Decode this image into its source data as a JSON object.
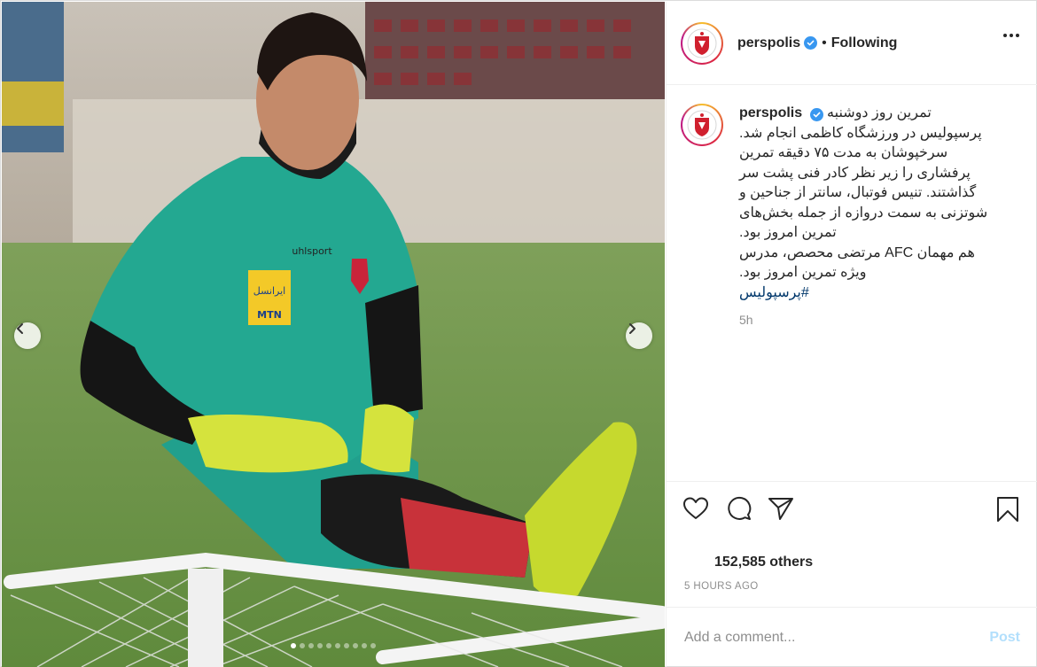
{
  "post": {
    "username": "perspolis",
    "separator": "•",
    "follow_status": "Following",
    "more_icon": "more-horizontal-icon",
    "verified_icon": "verified-badge-icon",
    "brand_color": "#3897f0"
  },
  "media": {
    "prev_icon": "chevron-left-icon",
    "next_icon": "chevron-right-icon",
    "carousel_dots": 10,
    "active_dot": 1,
    "sponsor_text_1": "ایرانسل",
    "sponsor_text_2": "MTN",
    "kit_brand": "uhlsport"
  },
  "caption": {
    "username": "perspolis",
    "lines": [
      "تمرین روز دوشنبه",
      "پرسپولیس در ورزشگاه کاظمی انجام شد.",
      "سرخپوشان به مدت ۷۵ دقیقه تمرین",
      "پرفشاری را زیر نظر کادر فنی پشت سر",
      "گذاشتند. تنیس فوتبال، سانتر از جناحین و",
      "شوتزنی به سمت دروازه از جمله بخش‌های",
      "تمرین امروز بود.",
      "هم مهمان AFC مرتضی محصص، مدرس",
      "ویژه تمرین امروز بود."
    ],
    "hashtag": "#پرسپولیس",
    "time": "5h"
  },
  "actions": {
    "like_icon": "heart-icon",
    "comment_icon": "comment-icon",
    "share_icon": "share-icon",
    "save_icon": "bookmark-icon",
    "likes_text": "152,585 others",
    "posted_time": "5 HOURS AGO"
  },
  "comment": {
    "placeholder": "Add a comment...",
    "post_label": "Post",
    "post_color": "#b2dffc"
  }
}
